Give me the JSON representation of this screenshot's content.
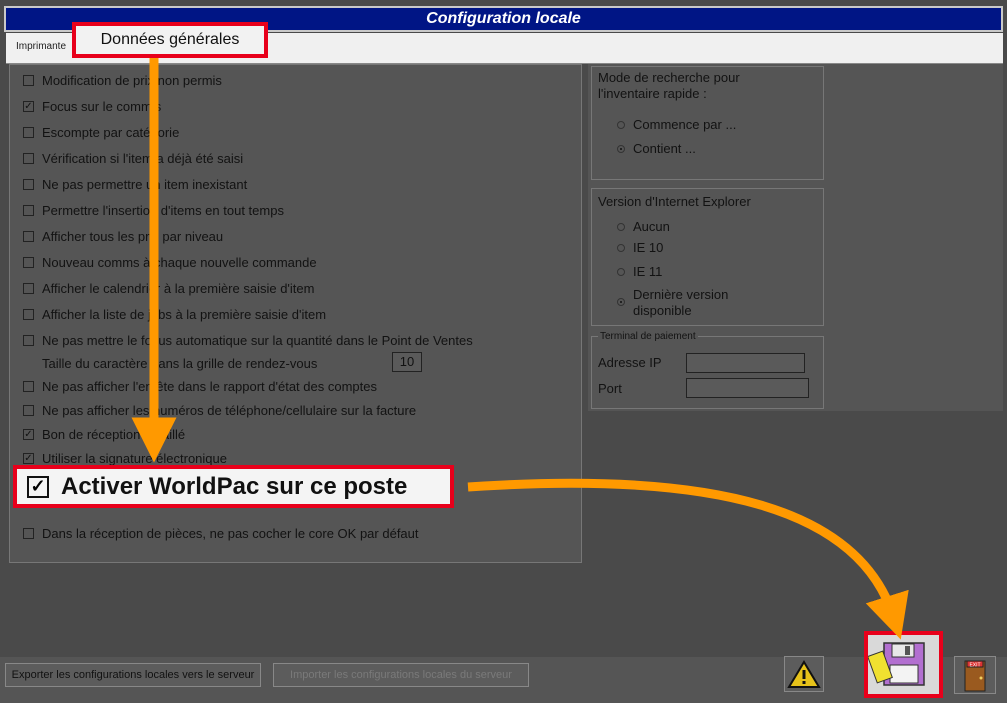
{
  "window": {
    "title": "Configuration locale"
  },
  "tabs": {
    "printers": "Imprimante",
    "general": "Données générales"
  },
  "options": [
    {
      "label": "Modification de prix non permis",
      "checked": false
    },
    {
      "label": "Focus sur le commis",
      "checked": true
    },
    {
      "label": "Escompte par catégorie",
      "checked": false
    },
    {
      "label": "Vérification si l'item a déjà été saisi",
      "checked": false
    },
    {
      "label": "Ne pas permettre un item inexistant",
      "checked": false
    },
    {
      "label": "Permettre l'insertion d'items en tout temps",
      "checked": false
    },
    {
      "label": "Afficher tous les prix par niveau",
      "checked": false
    },
    {
      "label": "Nouveau comms à chaque nouvelle commande",
      "checked": false
    },
    {
      "label": "Afficher le calendrier à la première saisie d'item",
      "checked": false
    },
    {
      "label": "Afficher la liste de jobs à la première saisie d'item",
      "checked": false
    },
    {
      "label": "Ne pas mettre le focus automatique sur la quantité dans le Point de Ventes",
      "checked": false
    }
  ],
  "font_size_label": "Taille du caractère dans la grille de rendez-vous",
  "font_size_value": "10",
  "options2": [
    {
      "label": "Ne pas afficher l'entête dans le rapport d'état des comptes",
      "checked": false
    },
    {
      "label": "Ne pas afficher les numéros de téléphone/cellulaire sur la facture",
      "checked": false
    },
    {
      "label": "Bon de réception détaillé",
      "checked": true
    },
    {
      "label": "Utiliser la signature électronique",
      "checked": true
    }
  ],
  "worldpac": {
    "label": "Activer WorldPac sur ce poste",
    "checked": true
  },
  "core_ok": {
    "label": "Dans la réception de pièces, ne pas cocher le core OK par défaut",
    "checked": false
  },
  "search_mode": {
    "title_line1": "Mode de recherche pour",
    "title_line2": "l'inventaire rapide :",
    "options": [
      "Commence par ...",
      "Contient ..."
    ],
    "selected": 1
  },
  "ie_version": {
    "title": "Version d'Internet Explorer",
    "options": [
      "Aucun",
      "IE 10",
      "IE 11",
      "Dernière version",
      "disponible"
    ],
    "selected": 3
  },
  "payment_terminal": {
    "title": "Terminal de paiement",
    "ip_label": "Adresse IP",
    "port_label": "Port",
    "ip_value": "",
    "port_value": ""
  },
  "footer": {
    "export_label": "Exporter les configurations locales vers le serveur",
    "import_label": "Importer les configurations locales du serveur",
    "exit_label": "EXIT"
  },
  "colors": {
    "title_bg": "#001585",
    "highlight": "#e8001b",
    "arrow": "#ff9900"
  }
}
